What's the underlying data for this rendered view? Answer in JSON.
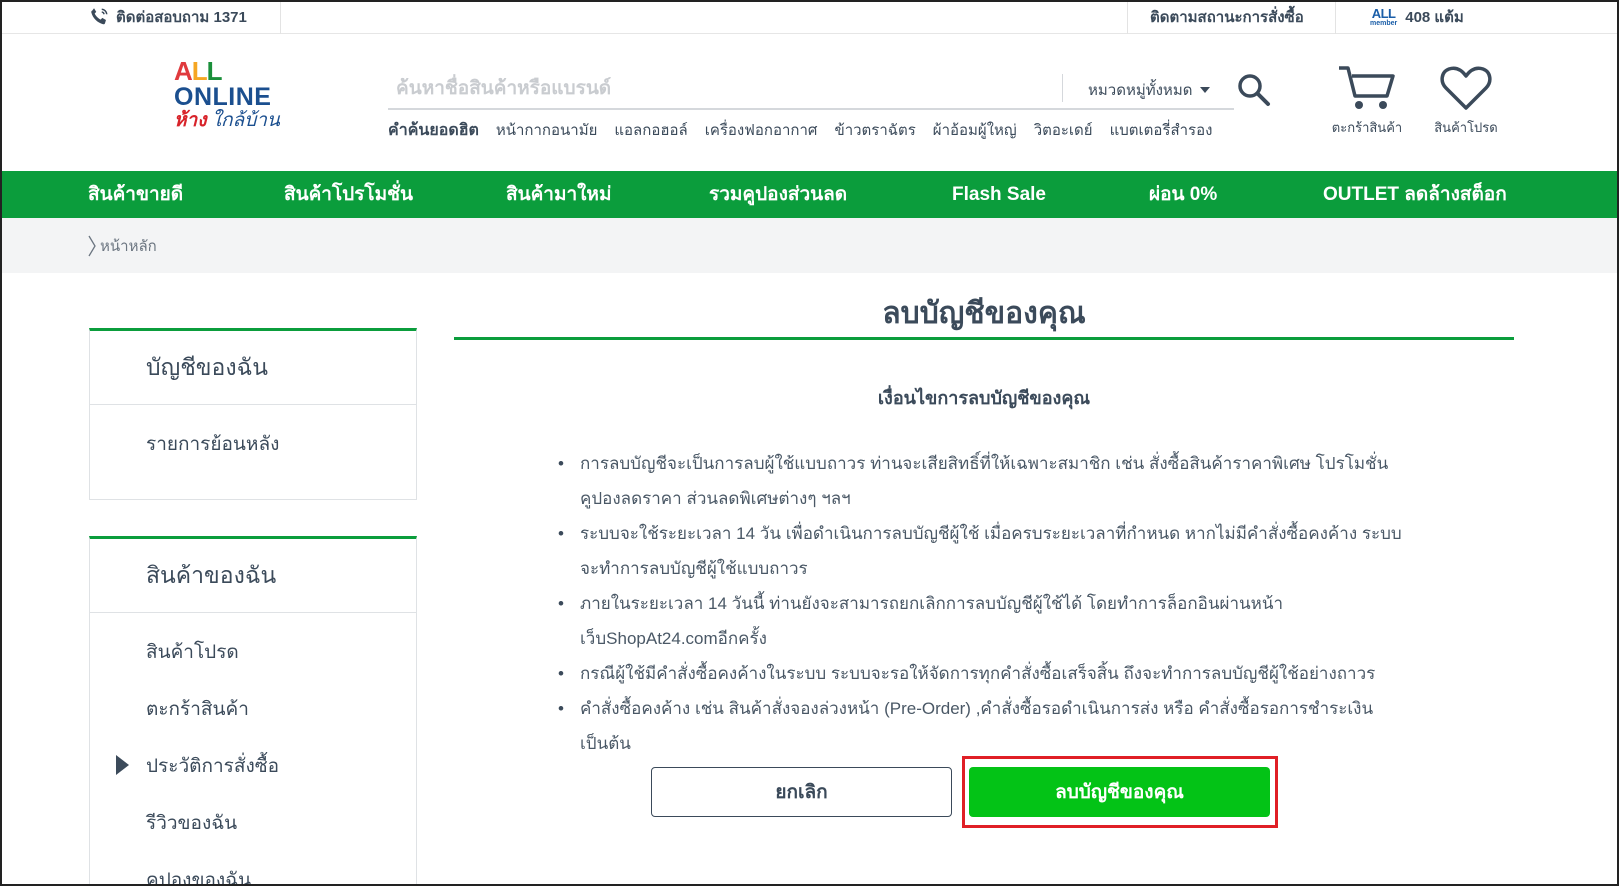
{
  "topbar": {
    "contact": "ติดต่อสอบถาม 1371",
    "track_order": "ติดตามสถานะการสั่งซื้อ",
    "member_logo": "ALL",
    "member_sub": "member",
    "points": "408 แต้ม"
  },
  "logo": {
    "line1_a": "A",
    "line1_b": "L",
    "line1_c": "L",
    "line2": "ONLINE",
    "line3_a": "ห้าง",
    "line3_b": " ใกล้บ้าน"
  },
  "search": {
    "placeholder": "ค้นหาชื่อสินค้าหรือแบรนด์",
    "category": "หมวดหมู่ทั้งหมด"
  },
  "hot_keywords": {
    "title": "คำค้นยอดฮิต",
    "items": [
      "หน้ากากอนามัย",
      "แอลกอฮอล์",
      "เครื่องฟอกอากาศ",
      "ข้าวตราฉัตร",
      "ผ้าอ้อมผู้ใหญ่",
      "วิตอะเดย์",
      "แบตเตอรี่สำรอง"
    ]
  },
  "header_icons": {
    "cart": "ตะกร้าสินค้า",
    "favorites": "สินค้าโปรด"
  },
  "nav": [
    "สินค้าขายดี",
    "สินค้าโปรโมชั่น",
    "สินค้ามาใหม่",
    "รวมคูปองส่วนลด",
    "Flash Sale",
    "ผ่อน 0%",
    "OUTLET ลดล้างสต็อก"
  ],
  "breadcrumb": "หน้าหลัก",
  "sidebar": {
    "account": {
      "title": "บัญชีของฉัน",
      "items": [
        "รายการย้อนหลัง"
      ]
    },
    "products": {
      "title": "สินค้าของฉัน",
      "items": [
        "สินค้าโปรด",
        "ตะกร้าสินค้า",
        "ประวัติการสั่งซื้อ",
        "รีวิวของฉัน",
        "คูปองของฉัน"
      ]
    }
  },
  "main": {
    "title": "ลบบัญชีของคุณ",
    "conditions_title": "เงื่อนไขการลบบัญชีของคุณ",
    "terms": [
      "การลบบัญชีจะเป็นการลบผู้ใช้แบบถาวร ท่านจะเสียสิทธิ์ที่ให้เฉพาะสมาชิก เช่น สั่งซื้อสินค้าราคาพิเศษ โปรโมชั่น คูปองลดราคา ส่วนลดพิเศษต่างๆ ฯลฯ",
      "ระบบจะใช้ระยะเวลา 14 วัน เพื่อดำเนินการลบบัญชีผู้ใช้ เมื่อครบระยะเวลาที่กำหนด หากไม่มีคำสั่งซื้อคงค้าง ระบบจะทำการลบบัญชีผู้ใช้แบบถาวร",
      "ภายในระยะเวลา 14 วันนี้ ท่านยังจะสามารถยกเลิกการลบบัญชีผู้ใช้ได้ โดยทำการล็อกอินผ่านหน้าเว็บShopAt24.comอีกครั้ง",
      "กรณีผู้ใช้มีคำสั่งซื้อคงค้างในระบบ ระบบจะรอให้จัดการทุกคำสั่งซื้อเสร็จสิ้น ถึงจะทำการลบบัญชีผู้ใช้อย่างถาวร",
      "คำสั่งซื้อคงค้าง เช่น สินค้าสั่งจองล่วงหน้า (Pre-Order) ,คำสั่งซื้อรอดำเนินการส่ง หรือ คำสั่งซื้อรอการชำระเงิน เป็นต้น"
    ],
    "cancel_label": "ยกเลิก",
    "delete_label": "ลบบัญชีของคุณ"
  },
  "colors": {
    "brand_green": "#0b9d3c",
    "button_green": "#03c316",
    "highlight_red": "#e01f26",
    "text": "#3b4a5a"
  }
}
